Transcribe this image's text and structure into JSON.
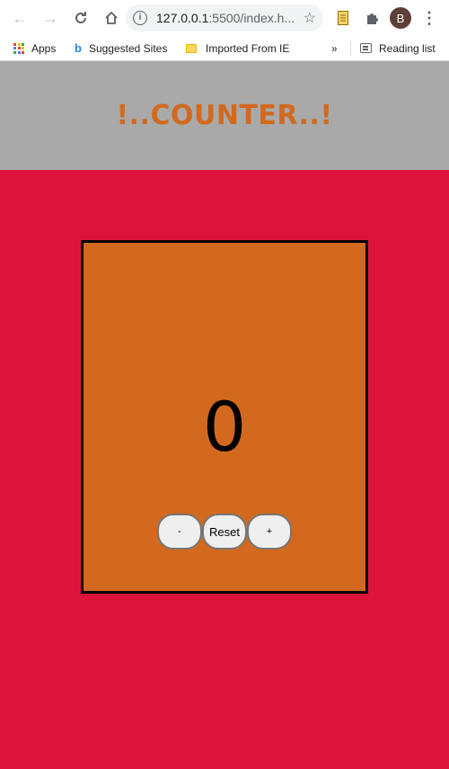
{
  "browser": {
    "url_main": "127.0.0.1",
    "url_rest": ":5500/index.h...",
    "avatar_letter": "B",
    "bookmarks": {
      "apps": "Apps",
      "suggested": "Suggested Sites",
      "imported": "Imported From IE",
      "overflow": "»",
      "reading_list": "Reading list"
    }
  },
  "page": {
    "title": "!..COUNTER..!",
    "count": "0",
    "buttons": {
      "decrement": "-",
      "reset": "Reset",
      "increment": "+"
    }
  },
  "colors": {
    "body_bg": "#dc143c",
    "header_bg": "#a9a9a9",
    "title": "#d2691e",
    "card_bg": "#d2691e",
    "card_border": "#000000"
  }
}
